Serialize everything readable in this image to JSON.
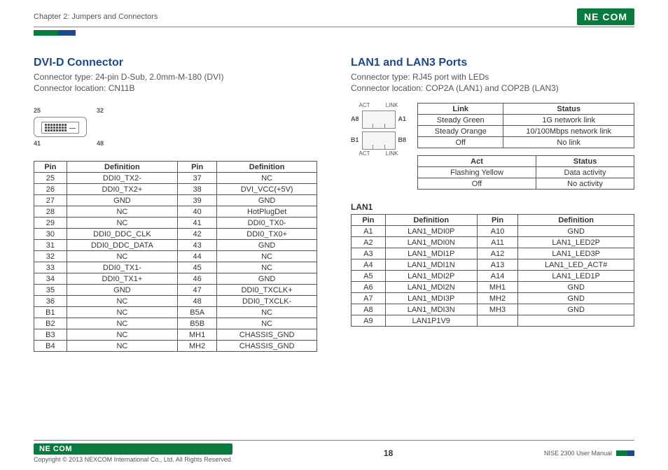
{
  "header": {
    "chapter": "Chapter 2: Jumpers and Connectors",
    "logo": "NE COM"
  },
  "left": {
    "title": "DVI-D Connector",
    "type": "Connector type: 24-pin D-Sub, 2.0mm-M-180 (DVI)",
    "loc": "Connector location: CN11B",
    "diagram": {
      "tl": "25",
      "tr": "32",
      "bl": "41",
      "br": "48"
    },
    "th": {
      "pinA": "Pin",
      "defA": "Definition",
      "pinB": "Pin",
      "defB": "Definition"
    },
    "rows": [
      {
        "a": "25",
        "ad": "DDI0_TX2-",
        "b": "37",
        "bd": "NC"
      },
      {
        "a": "26",
        "ad": "DDI0_TX2+",
        "b": "38",
        "bd": "DVI_VCC(+5V)"
      },
      {
        "a": "27",
        "ad": "GND",
        "b": "39",
        "bd": "GND"
      },
      {
        "a": "28",
        "ad": "NC",
        "b": "40",
        "bd": "HotPlugDet"
      },
      {
        "a": "29",
        "ad": "NC",
        "b": "41",
        "bd": "DDI0_TX0-"
      },
      {
        "a": "30",
        "ad": "DDI0_DDC_CLK",
        "b": "42",
        "bd": "DDI0_TX0+"
      },
      {
        "a": "31",
        "ad": "DDI0_DDC_DATA",
        "b": "43",
        "bd": "GND"
      },
      {
        "a": "32",
        "ad": "NC",
        "b": "44",
        "bd": "NC"
      },
      {
        "a": "33",
        "ad": "DDI0_TX1-",
        "b": "45",
        "bd": "NC"
      },
      {
        "a": "34",
        "ad": "DDI0_TX1+",
        "b": "46",
        "bd": "GND"
      },
      {
        "a": "35",
        "ad": "GND",
        "b": "47",
        "bd": "DDI0_TXCLK+"
      },
      {
        "a": "36",
        "ad": "NC",
        "b": "48",
        "bd": "DDI0_TXCLK-"
      },
      {
        "a": "B1",
        "ad": "NC",
        "b": "B5A",
        "bd": "NC"
      },
      {
        "a": "B2",
        "ad": "NC",
        "b": "B5B",
        "bd": "NC"
      },
      {
        "a": "B3",
        "ad": "NC",
        "b": "MH1",
        "bd": "CHASSIS_GND"
      },
      {
        "a": "B4",
        "ad": "NC",
        "b": "MH2",
        "bd": "CHASSIS_GND"
      }
    ]
  },
  "right": {
    "title": "LAN1 and LAN3 Ports",
    "type": "Connector type: RJ45 port with LEDs",
    "loc": "Connector location: COP2A (LAN1) and COP2B (LAN3)",
    "rj": {
      "act": "ACT",
      "link": "LINK",
      "a8": "A8",
      "a1": "A1",
      "b1": "B1",
      "b8": "B8"
    },
    "linkTable": {
      "h1": "Link",
      "h2": "Status",
      "rows": [
        {
          "a": "Steady Green",
          "b": "1G network link"
        },
        {
          "a": "Steady Orange",
          "b": "10/100Mbps network link"
        },
        {
          "a": "Off",
          "b": "No link"
        }
      ]
    },
    "actTable": {
      "h1": "Act",
      "h2": "Status",
      "rows": [
        {
          "a": "Flashing Yellow",
          "b": "Data activity"
        },
        {
          "a": "Off",
          "b": "No activity"
        }
      ]
    },
    "lan1": {
      "label": "LAN1",
      "th": {
        "pinA": "Pin",
        "defA": "Definition",
        "pinB": "Pin",
        "defB": "Definition"
      },
      "rows": [
        {
          "a": "A1",
          "ad": "LAN1_MDI0P",
          "b": "A10",
          "bd": "GND"
        },
        {
          "a": "A2",
          "ad": "LAN1_MDI0N",
          "b": "A11",
          "bd": "LAN1_LED2P"
        },
        {
          "a": "A3",
          "ad": "LAN1_MDI1P",
          "b": "A12",
          "bd": "LAN1_LED3P"
        },
        {
          "a": "A4",
          "ad": "LAN1_MDI1N",
          "b": "A13",
          "bd": "LAN1_LED_ACT#"
        },
        {
          "a": "A5",
          "ad": "LAN1_MDI2P",
          "b": "A14",
          "bd": "LAN1_LED1P"
        },
        {
          "a": "A6",
          "ad": "LAN1_MDI2N",
          "b": "MH1",
          "bd": "GND"
        },
        {
          "a": "A7",
          "ad": "LAN1_MDI3P",
          "b": "MH2",
          "bd": "GND"
        },
        {
          "a": "A8",
          "ad": "LAN1_MDI3N",
          "b": "MH3",
          "bd": "GND"
        },
        {
          "a": "A9",
          "ad": "LAN1P1V9",
          "b": "",
          "bd": ""
        }
      ]
    }
  },
  "footer": {
    "logo": "NE COM",
    "copyright": "Copyright © 2013 NEXCOM International Co., Ltd. All Rights Reserved.",
    "page": "18",
    "manual": "NISE 2300 User Manual"
  }
}
